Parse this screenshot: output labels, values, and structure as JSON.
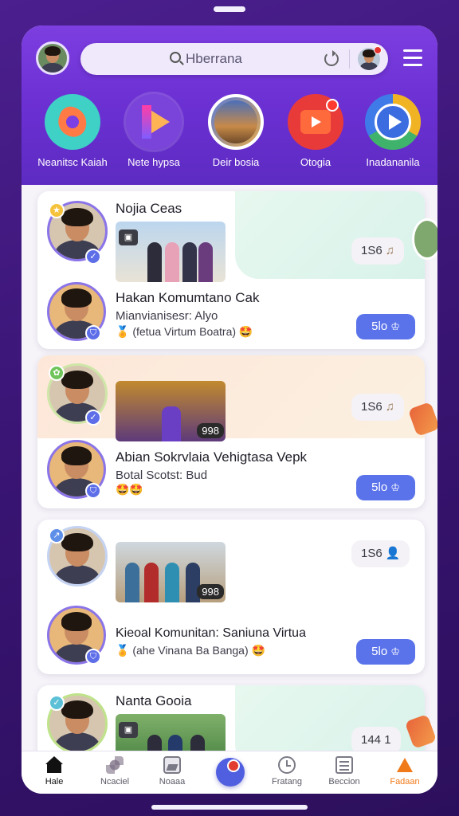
{
  "header": {
    "search_text": "Hberrana"
  },
  "stories": [
    {
      "label": "Neanitsc Kaiah",
      "icon": "blob-app-icon"
    },
    {
      "label": "Nete hypsa",
      "icon": "play-app-icon"
    },
    {
      "label": "Deir bosia",
      "icon": "photo-story-icon"
    },
    {
      "label": "Otogia",
      "icon": "video-camera-app-icon"
    },
    {
      "label": "Inadananila",
      "icon": "play-circle-app-icon"
    }
  ],
  "cards": [
    {
      "title_top": "Nojia Ceas",
      "title": "Hakan Komumtano Cak",
      "subtitle": "Mianvianisesr: Alyo",
      "meta": "(fetua Virtum Boatra)",
      "stat": "1S6",
      "action": "5lo"
    },
    {
      "title": "Abian Sokrvlaia Vehigtasa Vepk",
      "subtitle": "Botal Scotst: Bud",
      "count": "998",
      "stat": "1S6",
      "action": "5lo"
    },
    {
      "title": "Kieoal Komunitan: Saniuna Virtua",
      "meta": "(ahe Vinana Ba Banga)",
      "count": "998",
      "stat": "1S6",
      "action": "5lo"
    },
    {
      "title_top": "Nanta Gooia",
      "stat": "144 1"
    }
  ],
  "tabbar": [
    {
      "label": "Hale",
      "icon": "home-icon"
    },
    {
      "label": "Ncaciel",
      "icon": "social-icon"
    },
    {
      "label": "Noaaa",
      "icon": "photo-icon"
    },
    {
      "label": "",
      "icon": "record-icon"
    },
    {
      "label": "Fratang",
      "icon": "clock-icon"
    },
    {
      "label": "Beccion",
      "icon": "sessions-icon"
    },
    {
      "label": "Fadaan",
      "icon": "alert-icon"
    }
  ],
  "colors": {
    "brand_purple": "#6a2fd1",
    "action_blue": "#5a73ea",
    "accent_orange": "#f07a1a"
  }
}
